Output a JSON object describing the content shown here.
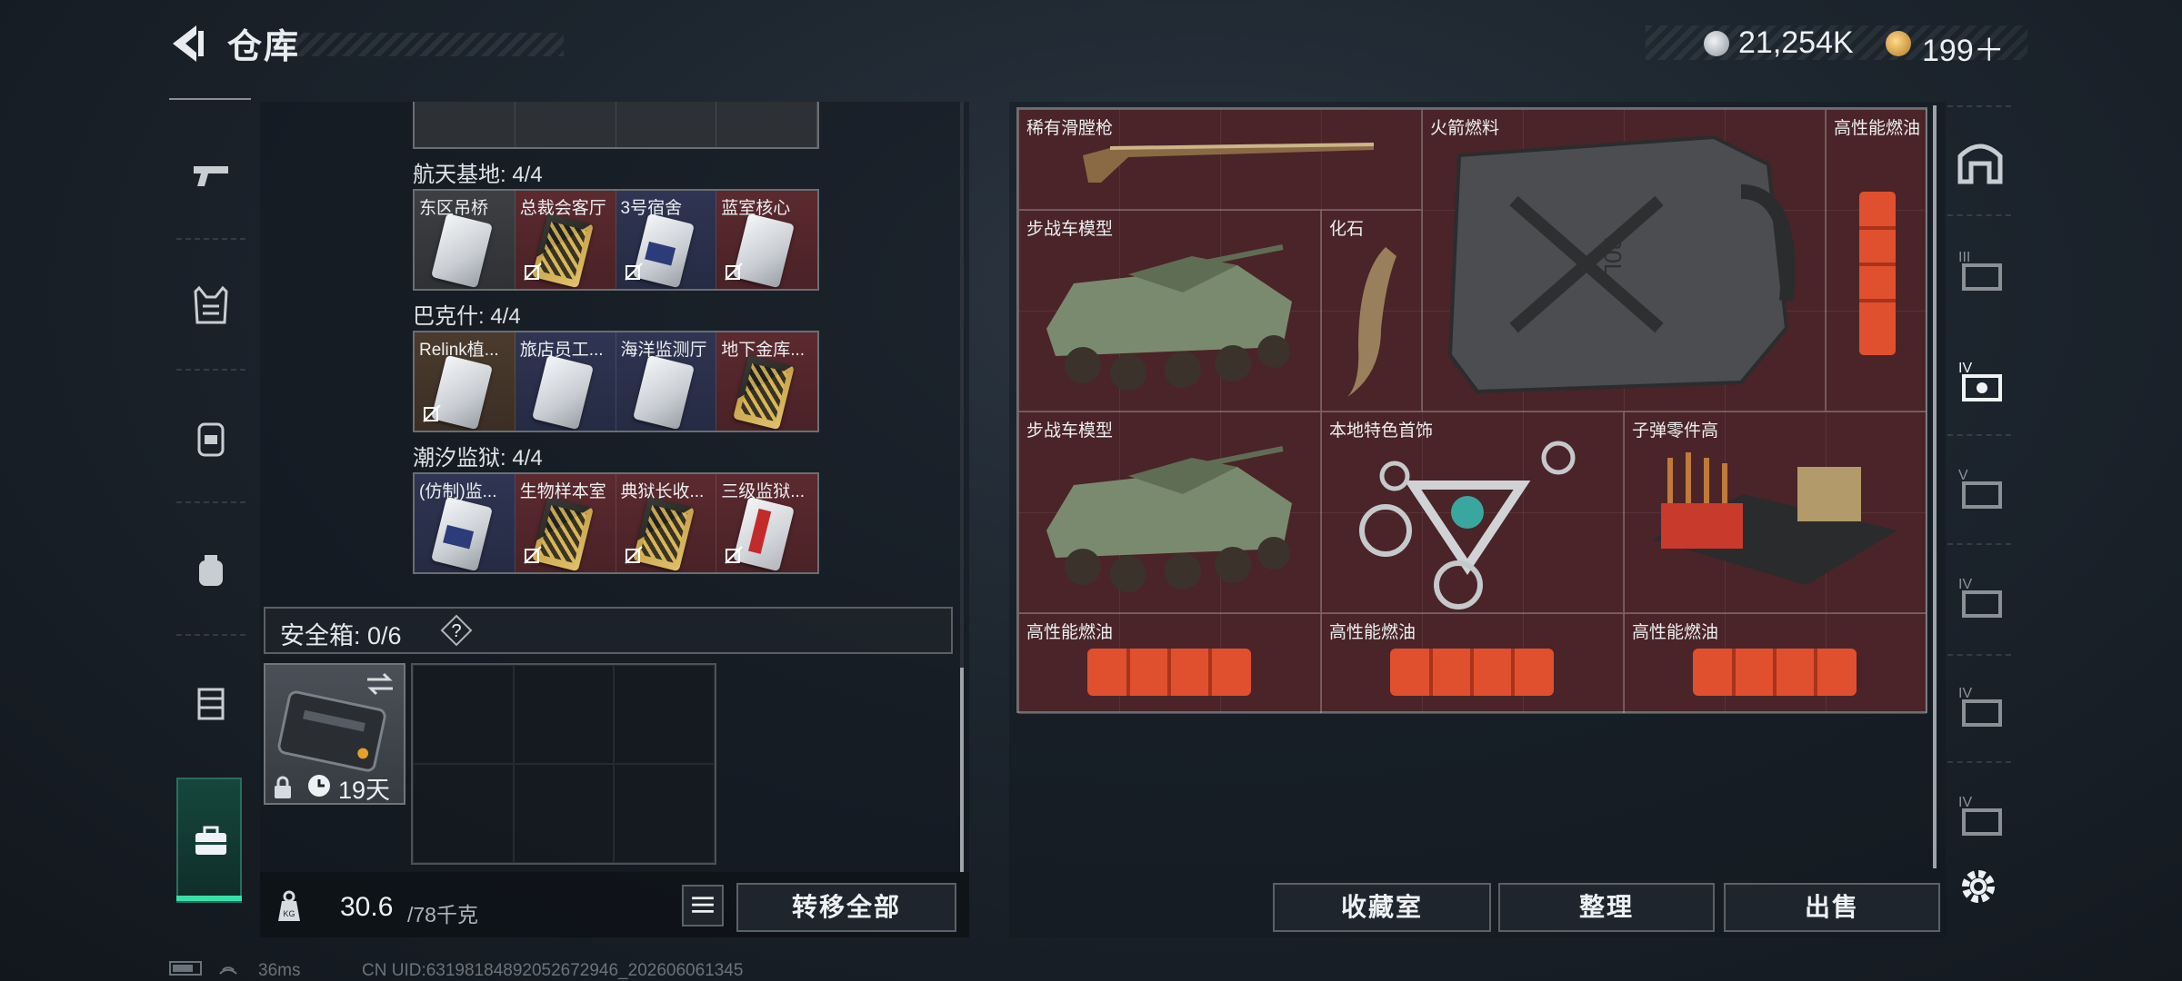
{
  "header": {
    "title": "仓库",
    "currency_coins": "21,254K",
    "currency_tokens": "199＋"
  },
  "left": {
    "sections": [
      {
        "title": "航天基地: 4/4",
        "keys": [
          {
            "name": "东区吊桥",
            "style": "silver"
          },
          {
            "name": "总裁会客厅",
            "style": "gold"
          },
          {
            "name": "3号宿舍",
            "style": "silver"
          },
          {
            "name": "蓝室核心",
            "style": "silver"
          }
        ]
      },
      {
        "title": "巴克什: 4/4",
        "keys": [
          {
            "name": "Relink植...",
            "style": "silver"
          },
          {
            "name": "旅店员工...",
            "style": "silver"
          },
          {
            "name": "海洋监测厅",
            "style": "silver"
          },
          {
            "name": "地下金库...",
            "style": "gold"
          }
        ]
      },
      {
        "title": "潮汐监狱: 4/4",
        "keys": [
          {
            "name": "(仿制)监...",
            "style": "silver"
          },
          {
            "name": "生物样本室",
            "style": "gold"
          },
          {
            "name": "典狱长收...",
            "style": "gold"
          },
          {
            "name": "三级监狱...",
            "style": "red"
          }
        ]
      }
    ],
    "safebox": {
      "label": "安全箱: 0/6",
      "help": "?",
      "days": "19天"
    },
    "weight": {
      "current": "30.6",
      "max": "/78千克"
    },
    "transfer_all": "转移全部"
  },
  "stash": {
    "items": [
      {
        "name": "稀有滑膛枪"
      },
      {
        "name": "火箭燃料"
      },
      {
        "name": "高性能燃油"
      },
      {
        "name": "步战车模型"
      },
      {
        "name": "化石"
      },
      {
        "name": "步战车模型"
      },
      {
        "name": "本地特色首饰"
      },
      {
        "name": "子弹零件高"
      },
      {
        "name": "高性能燃油"
      },
      {
        "name": "高性能燃油"
      },
      {
        "name": "高性能燃油"
      }
    ],
    "can_label": "20L"
  },
  "bottom_buttons": {
    "collection": "收藏室",
    "organize": "整理",
    "sell": "出售"
  },
  "status": {
    "ping": "36ms",
    "uid": "CN UID:631981848920526729​46_202606061345"
  },
  "colors": {
    "accent_green": "#38e0a6",
    "stash_bg": "#4a2428"
  }
}
